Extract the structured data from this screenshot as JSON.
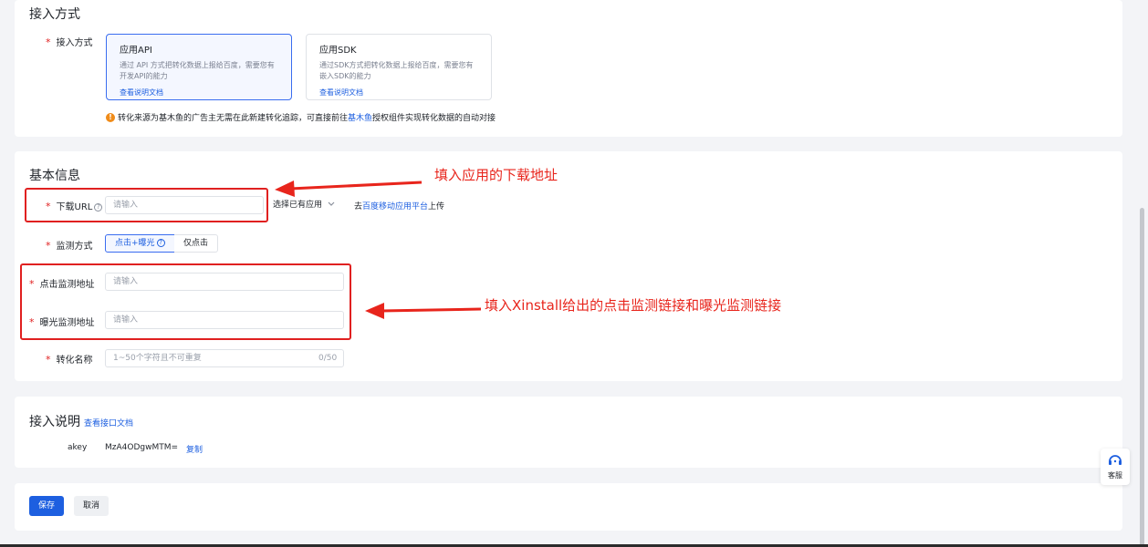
{
  "access_section": {
    "title": "接入方式",
    "field_label": "接入方式",
    "options": [
      {
        "title": "应用API",
        "desc": "通过 API 方式把转化数据上报给百度，需要您有开发API的能力",
        "link": "查看说明文档",
        "selected": true
      },
      {
        "title": "应用SDK",
        "desc": "通过SDK方式把转化数据上报给百度，需要您有嵌入SDK的能力",
        "link": "查看说明文档",
        "selected": false
      }
    ],
    "notice_prefix": "转化来源为基木鱼的广告主无需在此新建转化追踪，可直接前往",
    "notice_link": "基木鱼",
    "notice_suffix": "授权组件实现转化数据的自动对接"
  },
  "basic_section": {
    "title": "基本信息",
    "download_url": {
      "label": "下载URL",
      "placeholder": "请输入"
    },
    "select_app": "选择已有应用",
    "upload_prefix": "去",
    "upload_link": "百度移动应用平台",
    "upload_suffix": "上传",
    "monitor": {
      "label": "监测方式",
      "options": [
        "点击+曝光",
        "仅点击"
      ]
    },
    "click_monitor": {
      "label": "点击监测地址",
      "placeholder": "请输入"
    },
    "expose_monitor": {
      "label": "曝光监测地址",
      "placeholder": "请输入"
    },
    "conversion_name": {
      "label": "转化名称",
      "placeholder": "1~50个字符且不可重复",
      "counter": "0/50"
    }
  },
  "desc_section": {
    "title": "接入说明",
    "doc_link": "查看接口文档",
    "akey_label": "akey",
    "akey_value": "MzA4ODgwMTM=",
    "copy": "复制"
  },
  "actions": {
    "save": "保存",
    "cancel": "取消"
  },
  "annotations": {
    "download_note": "填入应用的下载地址",
    "monitor_note": "填入Xinstall给出的点击监测链接和曝光监测链接"
  },
  "support": {
    "label": "客服"
  },
  "colors": {
    "primary": "#1d5fe0",
    "annotation_red": "#e8251c",
    "background": "#f3f4f7"
  }
}
